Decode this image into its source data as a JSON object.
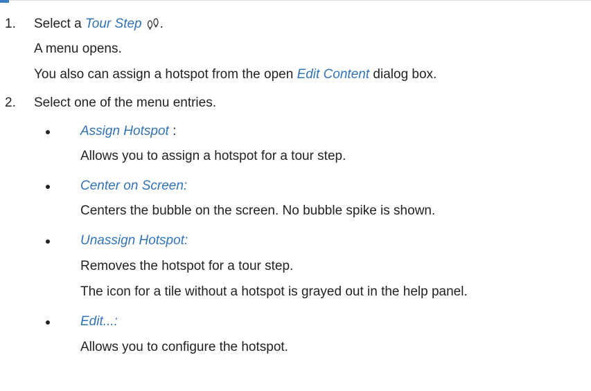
{
  "steps": [
    {
      "number": "1.",
      "prefix": "Select a ",
      "term": "Tour Step",
      "icon": "footsteps-icon",
      "suffix": ".",
      "lines": [
        "A menu opens.",
        {
          "before": "You also can assign a hotspot from the open ",
          "term": "Edit Content",
          "after": " dialog box."
        }
      ]
    },
    {
      "number": "2.",
      "text": "Select one of the menu entries.",
      "entries": [
        {
          "term": "Assign Hotspot",
          "term_suffix": " :",
          "lines": [
            "Allows you to assign a hotspot for a tour step."
          ]
        },
        {
          "term": "Center on Screen:",
          "lines": [
            "Centers the bubble on the screen. No bubble spike is shown."
          ]
        },
        {
          "term": "Unassign Hotspot:",
          "lines": [
            "Removes the hotspot for a tour step.",
            "The icon for a tile without a hotspot is grayed out in the help panel."
          ]
        },
        {
          "term": "Edit...:",
          "lines": [
            "Allows you to configure the hotspot."
          ]
        }
      ]
    }
  ]
}
